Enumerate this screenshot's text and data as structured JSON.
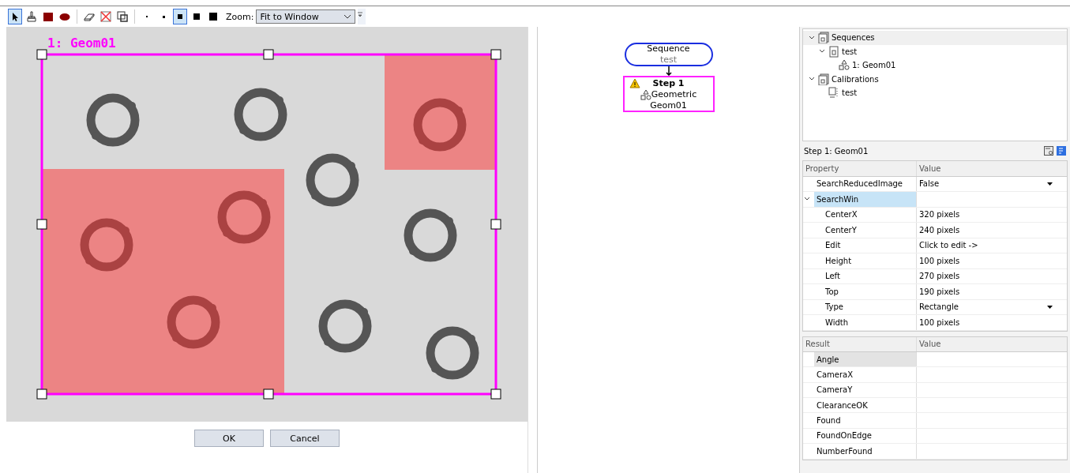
{
  "toolbar": {
    "tools": [
      {
        "kind": "pointer",
        "selected": true
      },
      {
        "kind": "brush",
        "selected": false
      },
      {
        "kind": "square",
        "selected": false
      },
      {
        "kind": "ellipse",
        "selected": false
      },
      {
        "kind": "eraser",
        "selected": false
      },
      {
        "kind": "clear",
        "selected": false
      },
      {
        "kind": "fill",
        "selected": false
      },
      {
        "kind": "dot-small",
        "selected": false
      },
      {
        "kind": "dot-medium",
        "selected": false
      },
      {
        "kind": "pen-small",
        "selected": true
      },
      {
        "kind": "pen-medium",
        "selected": false
      },
      {
        "kind": "pen-large",
        "selected": false
      }
    ],
    "zoom_label": "Zoom:",
    "zoom_value": "Fit to Window"
  },
  "image_editor": {
    "label": "1: Geom01",
    "buttons": [
      "OK",
      "Cancel"
    ]
  },
  "flow": {
    "sequence": {
      "title": "Sequence",
      "name": "test"
    },
    "step": {
      "title": "Step 1",
      "type": "Geometric",
      "name": "Geom01",
      "warning": true
    }
  },
  "tree": [
    {
      "label": "Sequences",
      "kind": "folder",
      "expanded": true,
      "children": [
        {
          "label": "test",
          "kind": "sequence",
          "expanded": true,
          "children": [
            {
              "label": "1: Geom01",
              "kind": "geometric"
            }
          ]
        }
      ]
    },
    {
      "label": "Calibrations",
      "kind": "folder",
      "expanded": true,
      "children": [
        {
          "label": "test",
          "kind": "calibration"
        }
      ]
    }
  ],
  "properties": {
    "title": "Step 1: Geom01",
    "columns": [
      "Property",
      "Value"
    ],
    "rows": [
      {
        "name": "SearchReducedImage",
        "value": "False",
        "kind": "dropdown",
        "selected": false
      },
      {
        "name": "SearchWin",
        "kind": "category",
        "expanded": true,
        "selected": true,
        "children": [
          {
            "name": "CenterX",
            "value": "320  pixels",
            "kind": "text",
            "selected": false
          },
          {
            "name": "CenterY",
            "value": "240  pixels",
            "kind": "text",
            "selected": false
          },
          {
            "name": "Edit",
            "value": "Click to edit ->",
            "kind": "text",
            "selected": false
          },
          {
            "name": "Height",
            "value": "100  pixels",
            "kind": "text",
            "selected": false
          },
          {
            "name": "Left",
            "value": "270  pixels",
            "kind": "text",
            "selected": false
          },
          {
            "name": "Top",
            "value": "190  pixels",
            "kind": "text",
            "selected": false
          },
          {
            "name": "Type",
            "value": "Rectangle",
            "kind": "dropdown",
            "selected": false
          },
          {
            "name": "Width",
            "value": "100  pixels",
            "kind": "text",
            "selected": false
          }
        ]
      }
    ]
  },
  "results": {
    "columns": [
      "Result",
      "Value"
    ],
    "rows": [
      {
        "name": "Angle",
        "selected": true
      },
      {
        "name": "CameraX",
        "selected": false
      },
      {
        "name": "CameraY",
        "selected": false
      },
      {
        "name": "ClearanceOK",
        "selected": false
      },
      {
        "name": "Found",
        "selected": false
      },
      {
        "name": "FoundOnEdge",
        "selected": false
      },
      {
        "name": "NumberFound",
        "selected": false
      }
    ]
  }
}
